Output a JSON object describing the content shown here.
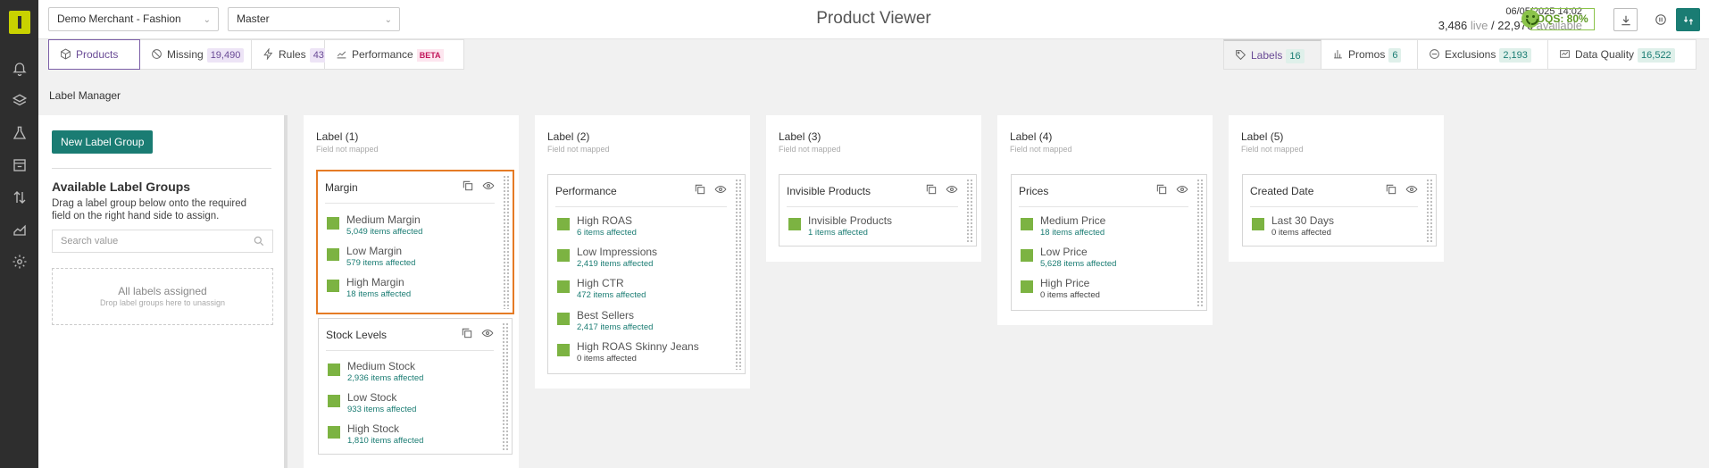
{
  "header": {
    "merchant_select": "Demo Merchant - Fashion",
    "feed_select": "Master",
    "title": "Product Viewer",
    "datetime": "06/05/2025 14:02",
    "live_count": "3,486",
    "live_label": "live",
    "separator": "/",
    "available_count": "22,976",
    "available_label": "available",
    "dqs": "DQS: 80%"
  },
  "tabs_left": [
    {
      "label": "Products",
      "icon": "box-icon"
    },
    {
      "label": "Missing",
      "badge": "19,490",
      "icon": "ban-icon"
    },
    {
      "label": "Rules",
      "badge": "43",
      "icon": "bolt-icon"
    },
    {
      "label": "Performance",
      "beta": "BETA",
      "icon": "chart-icon"
    }
  ],
  "tabs_right": [
    {
      "label": "Labels",
      "badge": "16",
      "icon": "tag-icon"
    },
    {
      "label": "Promos",
      "badge": "6",
      "icon": "bars-icon"
    },
    {
      "label": "Exclusions",
      "badge": "2,193",
      "icon": "minus-circle-icon"
    },
    {
      "label": "Data Quality",
      "badge": "16,522",
      "icon": "quality-icon"
    }
  ],
  "section_title": "Label Manager",
  "left_panel": {
    "new_button": "New Label Group",
    "available_title": "Available Label Groups",
    "available_desc": "Drag a label group below onto the required field on the right hand side to assign.",
    "search_placeholder": "Search value",
    "dropzone_title": "All labels assigned",
    "dropzone_sub": "Drop label groups here to unassign"
  },
  "columns": [
    {
      "title": "Label (1)",
      "sub": "Field not mapped",
      "groups": [
        {
          "name": "Margin",
          "items": [
            {
              "name": "Medium Margin",
              "count": "5,049 items affected"
            },
            {
              "name": "Low Margin",
              "count": "579 items affected"
            },
            {
              "name": "High Margin",
              "count": "18 items affected"
            }
          ]
        },
        {
          "name": "Stock Levels",
          "items": [
            {
              "name": "Medium Stock",
              "count": "2,936 items affected"
            },
            {
              "name": "Low Stock",
              "count": "933 items affected"
            },
            {
              "name": "High Stock",
              "count": "1,810 items affected"
            }
          ]
        }
      ]
    },
    {
      "title": "Label (2)",
      "sub": "Field not mapped",
      "groups": [
        {
          "name": "Performance",
          "items": [
            {
              "name": "High ROAS",
              "count": "6 items affected"
            },
            {
              "name": "Low Impressions",
              "count": "2,419 items affected"
            },
            {
              "name": "High CTR",
              "count": "472 items affected"
            },
            {
              "name": "Best Sellers",
              "count": "2,417 items affected"
            },
            {
              "name": "High ROAS Skinny Jeans",
              "count": "0 items affected"
            }
          ]
        }
      ]
    },
    {
      "title": "Label (3)",
      "sub": "Field not mapped",
      "groups": [
        {
          "name": "Invisible Products",
          "items": [
            {
              "name": "Invisible Products",
              "count": "1 items affected"
            }
          ]
        }
      ]
    },
    {
      "title": "Label (4)",
      "sub": "Field not mapped",
      "groups": [
        {
          "name": "Prices",
          "items": [
            {
              "name": "Medium Price",
              "count": "18 items affected"
            },
            {
              "name": "Low Price",
              "count": "5,628 items affected"
            },
            {
              "name": "High Price",
              "count": "0 items affected"
            }
          ]
        }
      ]
    },
    {
      "title": "Label (5)",
      "sub": "Field not mapped",
      "groups": [
        {
          "name": "Created Date",
          "items": [
            {
              "name": "Last 30 Days",
              "count": "0 items affected"
            }
          ]
        }
      ]
    }
  ],
  "colors": {
    "accent": "#1a7c73",
    "label_swatch": "#7cb342",
    "highlight": "#e57b25",
    "rail": "#2e2e2e"
  }
}
